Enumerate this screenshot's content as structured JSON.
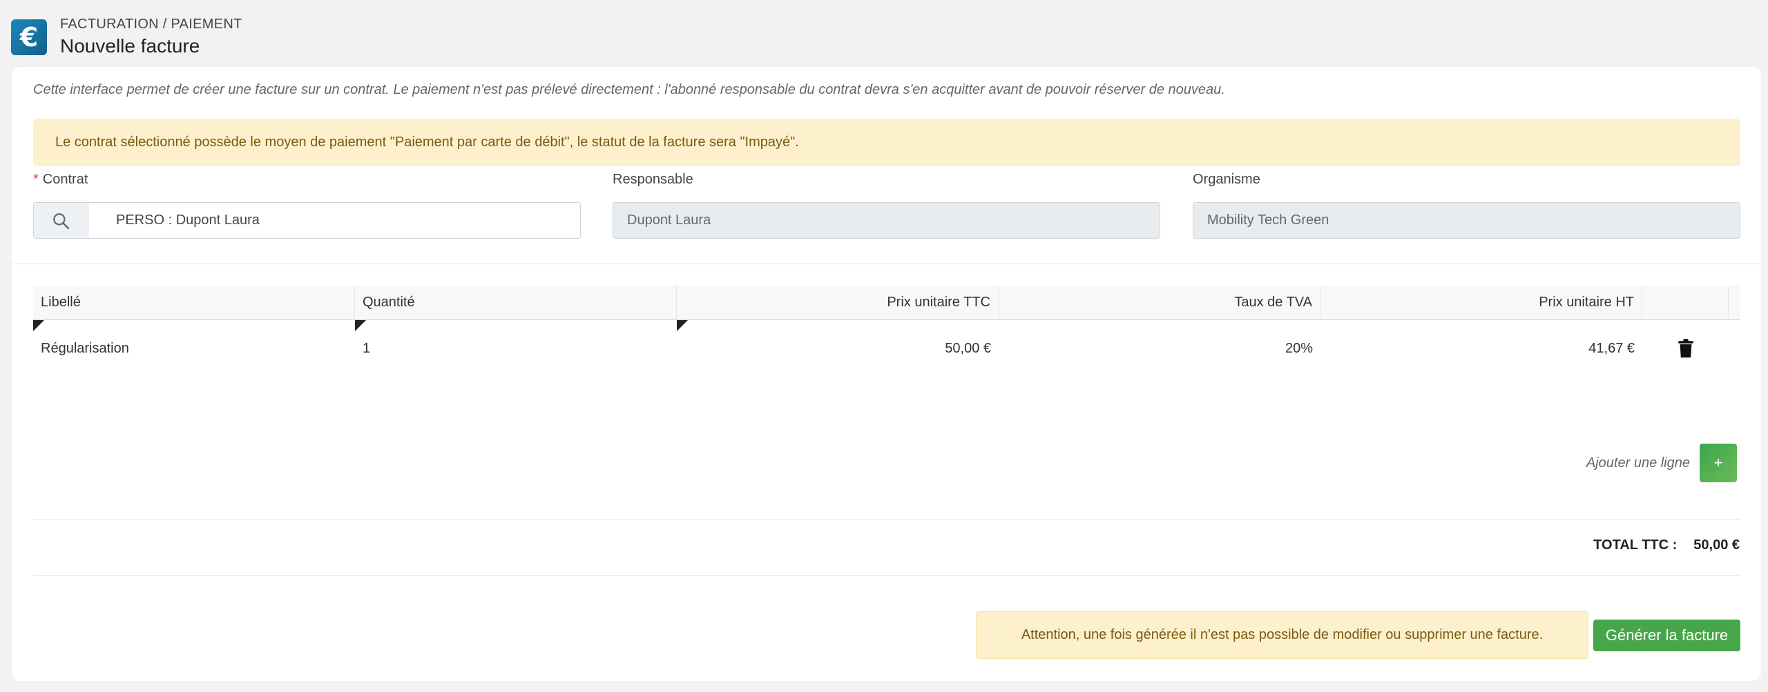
{
  "header": {
    "app_icon_symbol": "€",
    "breadcrumb": "FACTURATION / PAIEMENT",
    "title": "Nouvelle facture"
  },
  "intro_text": "Cette interface permet de créer une facture sur un contrat. Le paiement n'est pas prélevé directement : l'abonné responsable du contrat devra s'en acquitter avant de pouvoir réserver de nouveau.",
  "alert_text": "Le contrat sélectionné possède le moyen de paiement \"Paiement par carte de débit\", le statut de la facture sera \"Impayé\".",
  "fields": {
    "contrat": {
      "required_mark": "*",
      "label": "Contrat",
      "value": "PERSO : Dupont Laura"
    },
    "responsable": {
      "label": "Responsable",
      "value": "Dupont Laura"
    },
    "organisme": {
      "label": "Organisme",
      "value": "Mobility Tech Green"
    }
  },
  "table": {
    "columns": [
      "Libellé",
      "Quantité",
      "Prix unitaire TTC",
      "Taux de TVA",
      "Prix unitaire HT"
    ],
    "rows": [
      {
        "libelle": "Régularisation",
        "quantite": "1",
        "prix_ttc": "50,00 €",
        "tva": "20%",
        "prix_ht": "41,67 €"
      }
    ]
  },
  "add_line": {
    "label": "Ajouter une ligne",
    "button": "+"
  },
  "total": {
    "label": "TOTAL TTC :",
    "value": "50,00 €"
  },
  "warning_text": "Attention, une fois générée il n'est pas possible de modifier ou supprimer une facture.",
  "generate_button": "Générer la facture",
  "colors": {
    "accent_green": "#48a64a",
    "alert_bg": "#fdf0cc",
    "icon_blue": "#1e88b8"
  }
}
